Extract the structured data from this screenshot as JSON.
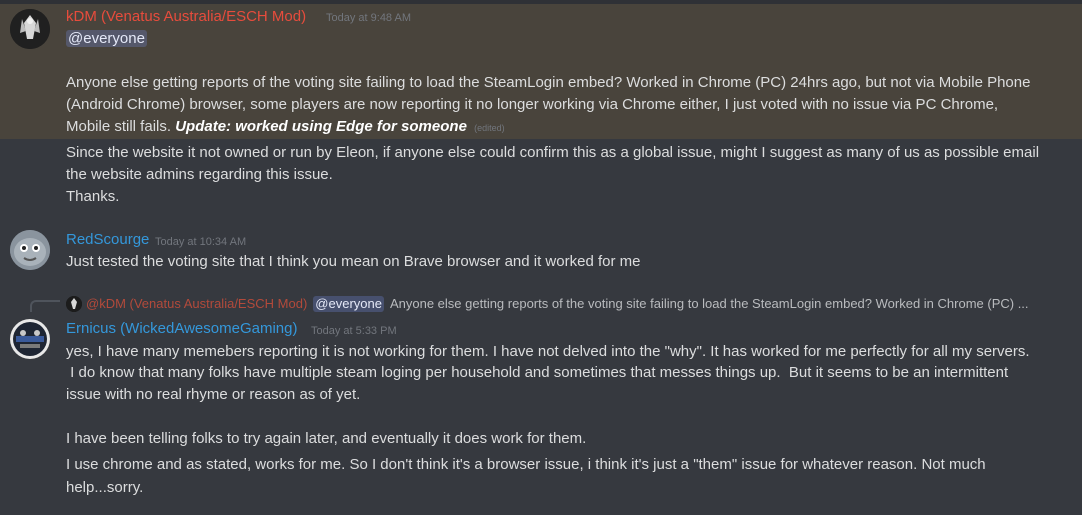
{
  "colors": {
    "background": "#36393f",
    "highlight": "#49443c",
    "mod_name": "#e74c3c",
    "redscourge_name": "#3498db",
    "ernicus_name": "#3498db",
    "timestamp": "#72767d",
    "text": "#dcddde"
  },
  "messages": [
    {
      "author": "kDM (Venatus Australia/ESCH Mod)",
      "timestamp": "Today at 9:48 AM",
      "mention": "@everyone",
      "lines": [
        "Anyone else getting reports of the voting site failing to load the SteamLogin embed? Worked in Chrome (PC) 24hrs ago, but not via Mobile Phone",
        "(Android Chrome) browser, some players are now reporting it no longer working via Chrome either, I just voted with no issue via PC Chrome,"
      ],
      "line3_prefix": "Mobile still fails.",
      "update": "Update: worked using Edge for someone",
      "edited": "(edited)",
      "followup": [
        "Since the website it not owned or run by Eleon, if anyone else could confirm this as a global issue, might I suggest as many of us as possible email",
        "the website admins regarding this issue.",
        "Thanks."
      ]
    },
    {
      "author": "RedScourge",
      "timestamp": "Today at 10:34 AM",
      "lines": [
        "Just tested the voting site that I think you mean on Brave browser and it worked for me"
      ]
    },
    {
      "reply": {
        "author": "@kDM (Venatus Australia/ESCH Mod)",
        "mention": "@everyone",
        "text": "Anyone else getting reports of the voting site failing to load the SteamLogin embed? Worked in Chrome (PC) ..."
      },
      "author": "Ernicus (WickedAwesomeGaming)",
      "timestamp": "Today at 5:33 PM",
      "lines": [
        "yes, I have many memebers reporting it is not working for them.  I have not delved into the \"why\".  It has worked for me perfectly for all my servers.",
        " I do know that many folks have multiple steam loging per household and sometimes that messes things up.  But it seems to be an intermittent",
        "issue with no real rhyme or reason as of yet.",
        "I have been telling folks to try again later, and eventually it does work for them.",
        "I use chrome and as stated, works for me.  So I don't think it's a browser issue, i think it's just a \"them\" issue for whatever reason. Not much",
        "help...sorry."
      ]
    }
  ]
}
